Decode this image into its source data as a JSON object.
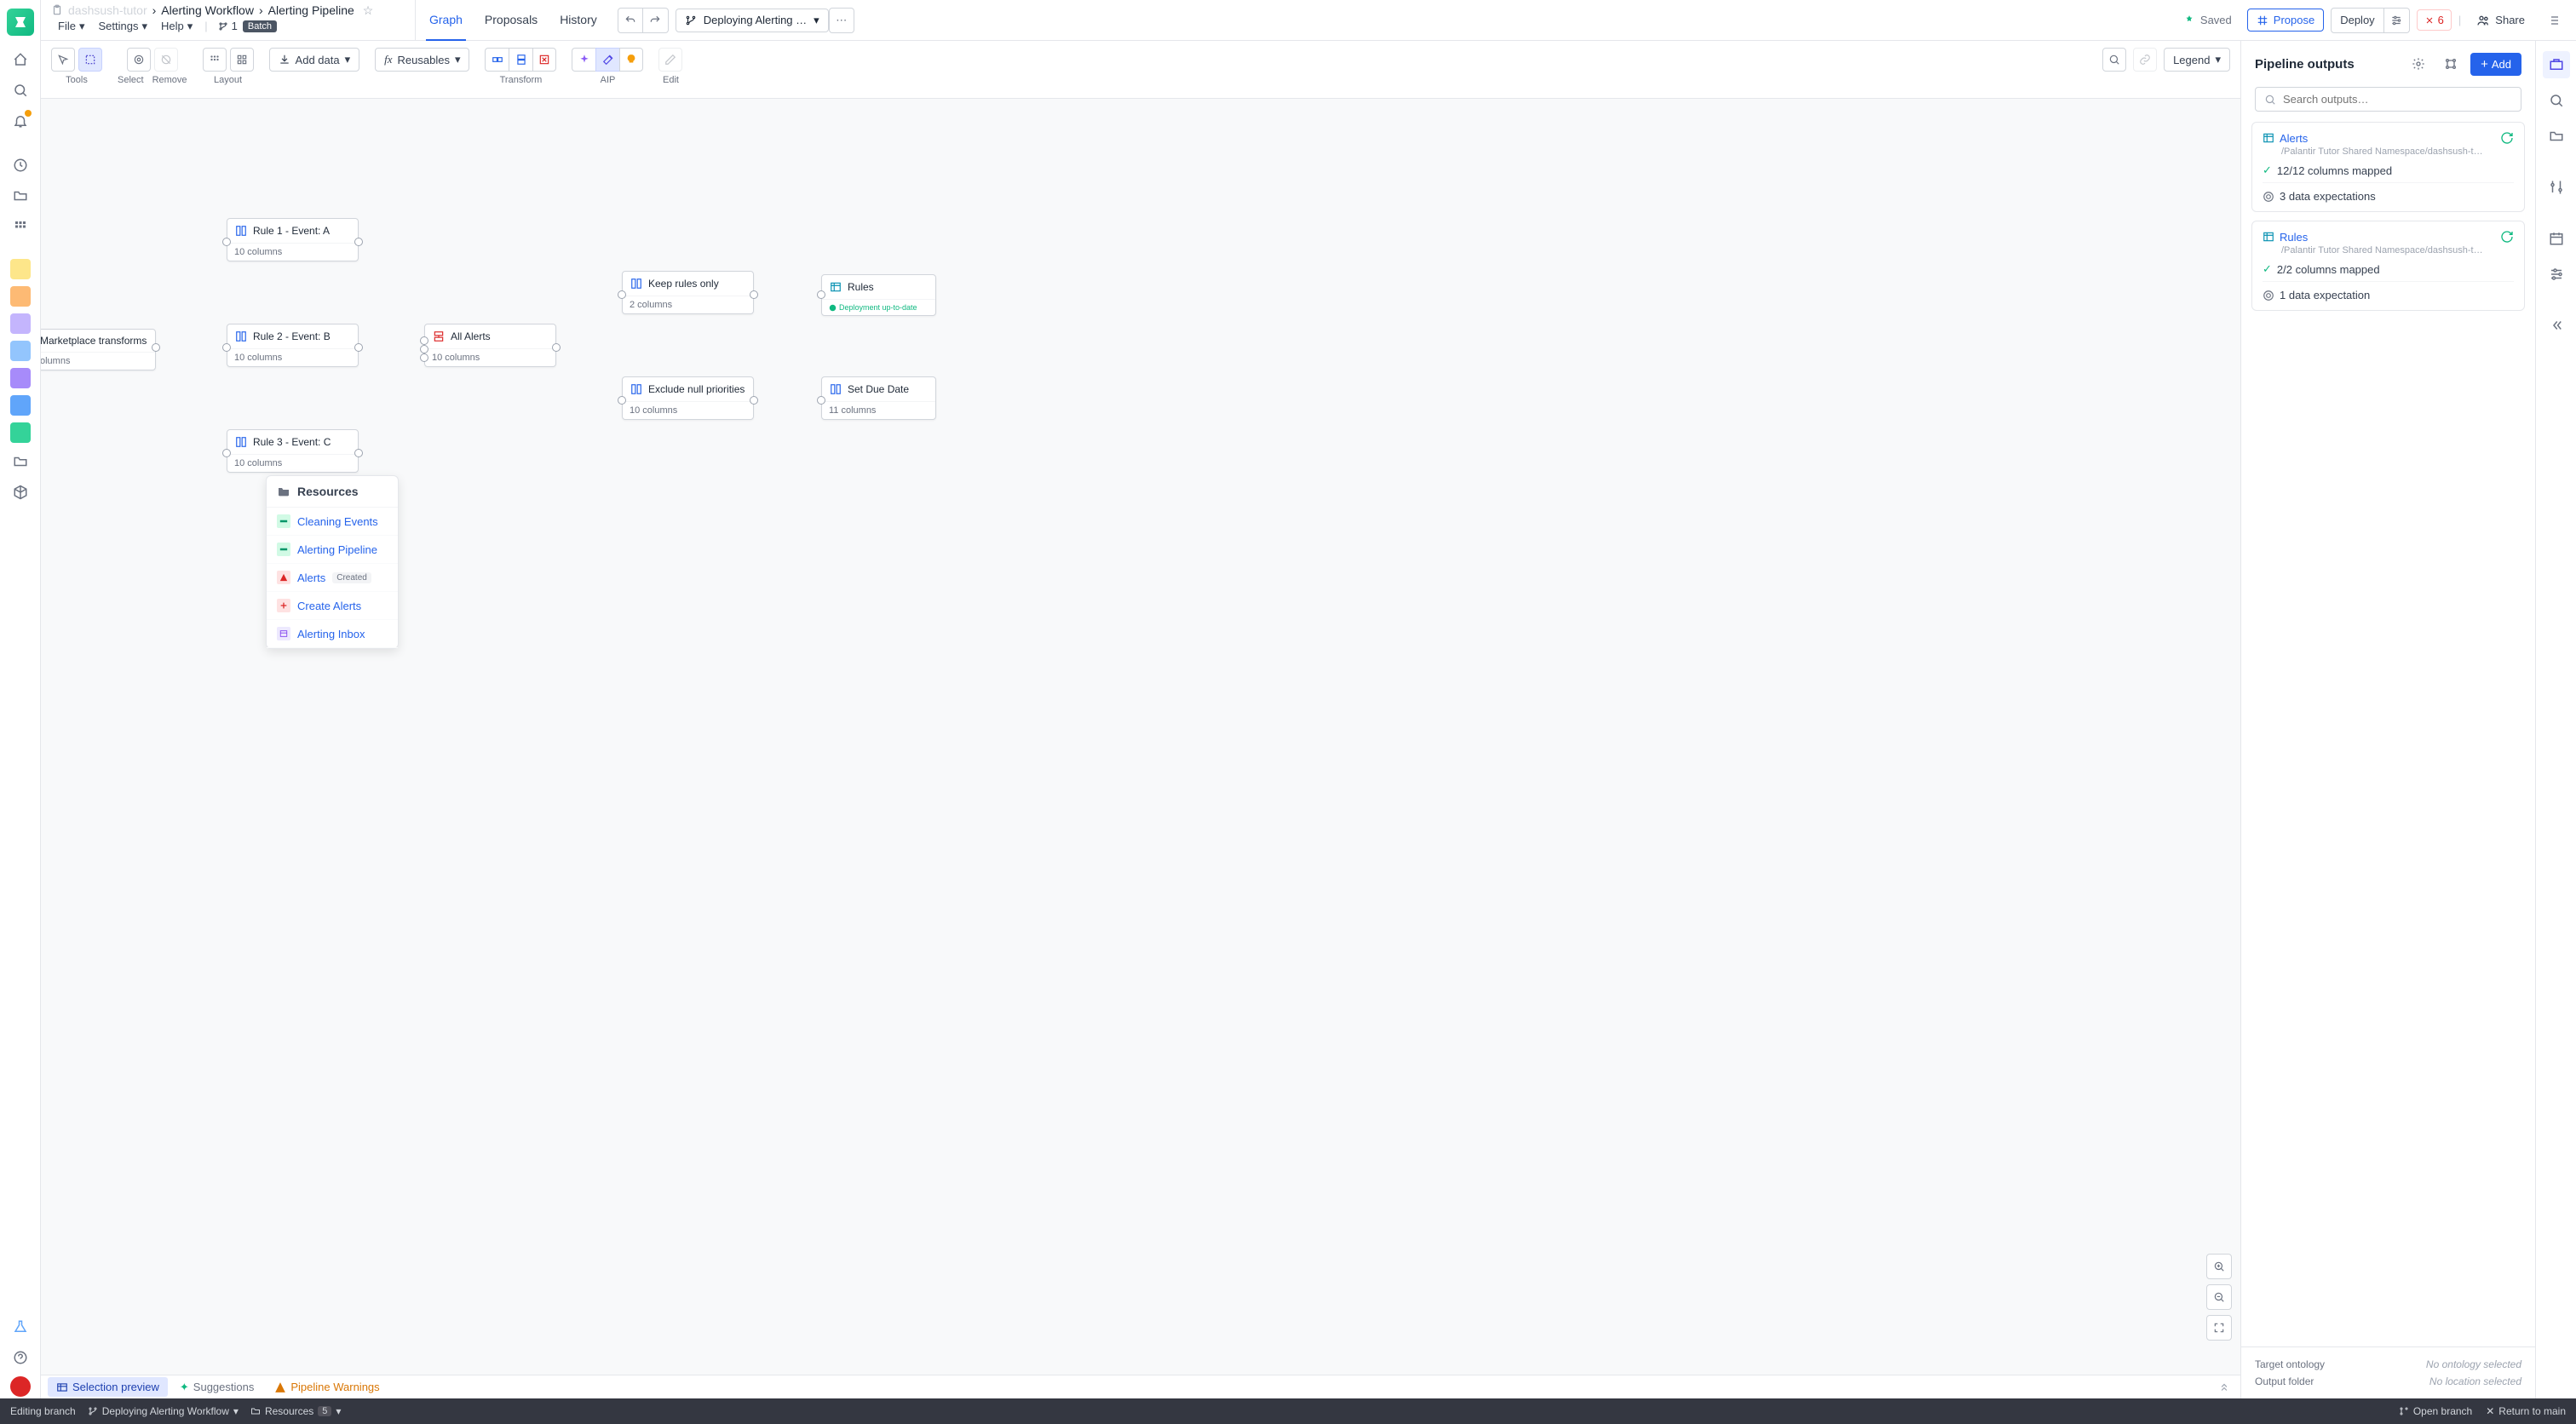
{
  "breadcrumbs": {
    "root_icon": "clipboard",
    "root": "dashsush-tutor",
    "mid": "Alerting Workflow",
    "leaf": "Alerting Pipeline"
  },
  "menus": {
    "file": "File",
    "settings": "Settings",
    "help": "Help",
    "branch_count": "1",
    "batch": "Batch"
  },
  "top_tabs": {
    "graph": "Graph",
    "proposals": "Proposals",
    "history": "History"
  },
  "top_actions": {
    "deploying": "Deploying Alerting …",
    "saved": "Saved",
    "propose": "Propose",
    "deploy": "Deploy",
    "error_count": "6",
    "share": "Share"
  },
  "toolbar": {
    "tools": "Tools",
    "select": "Select",
    "remove": "Remove",
    "layout": "Layout",
    "add_data": "Add data",
    "reusables": "Reusables",
    "transform": "Transform",
    "aip": "AIP",
    "edit": "Edit",
    "legend": "Legend"
  },
  "nodes": {
    "marketplace": {
      "title": "Marketplace transforms",
      "sub": "olumns"
    },
    "rule1": {
      "title": "Rule 1 - Event: A",
      "sub": "10 columns"
    },
    "rule2": {
      "title": "Rule 2 - Event: B",
      "sub": "10 columns"
    },
    "rule3": {
      "title": "Rule 3 - Event: C",
      "sub": "10 columns"
    },
    "all_alerts": {
      "title": "All Alerts",
      "sub": "10 columns"
    },
    "keep_rules": {
      "title": "Keep rules only",
      "sub": "2 columns"
    },
    "exclude_null": {
      "title": "Exclude null priorities",
      "sub": "10 columns"
    },
    "rules": {
      "title": "Rules",
      "deploy": "Deployment up-to-date"
    },
    "due_date": {
      "title": "Set Due Date",
      "sub": "11 columns"
    }
  },
  "resources": {
    "header": "Resources",
    "items": [
      {
        "label": "Cleaning Events",
        "color": "#10b981",
        "icon": "pipeline"
      },
      {
        "label": "Alerting Pipeline",
        "color": "#10b981",
        "icon": "pipeline"
      },
      {
        "label": "Alerts",
        "color": "#dc2626",
        "icon": "alert",
        "tag": "Created"
      },
      {
        "label": "Create Alerts",
        "color": "#dc2626",
        "icon": "plus"
      },
      {
        "label": "Alerting Inbox",
        "color": "#7c3aed",
        "icon": "table"
      }
    ]
  },
  "bottom_tabs": {
    "selection": "Selection preview",
    "suggestions": "Suggestions",
    "warnings": "Pipeline Warnings"
  },
  "right_panel": {
    "title": "Pipeline outputs",
    "add": "Add",
    "search_placeholder": "Search outputs…",
    "outputs": [
      {
        "name": "Alerts",
        "path": "/Palantir     Tutor Shared Namespace/dashsush-t…",
        "mapped": "12/12 columns mapped",
        "expect": "3 data expectations"
      },
      {
        "name": "Rules",
        "path": "/Palantir     Tutor Shared Namespace/dashsush-t…",
        "mapped": "2/2 columns mapped",
        "expect": "1 data expectation"
      }
    ],
    "footer": {
      "ontology_label": "Target ontology",
      "ontology_value": "No ontology selected",
      "folder_label": "Output folder",
      "folder_value": "No location selected"
    }
  },
  "statusbar": {
    "editing": "Editing branch",
    "branch": "Deploying Alerting Workflow",
    "resources": "Resources",
    "resources_count": "5",
    "open_branch": "Open branch",
    "return": "Return to main"
  }
}
